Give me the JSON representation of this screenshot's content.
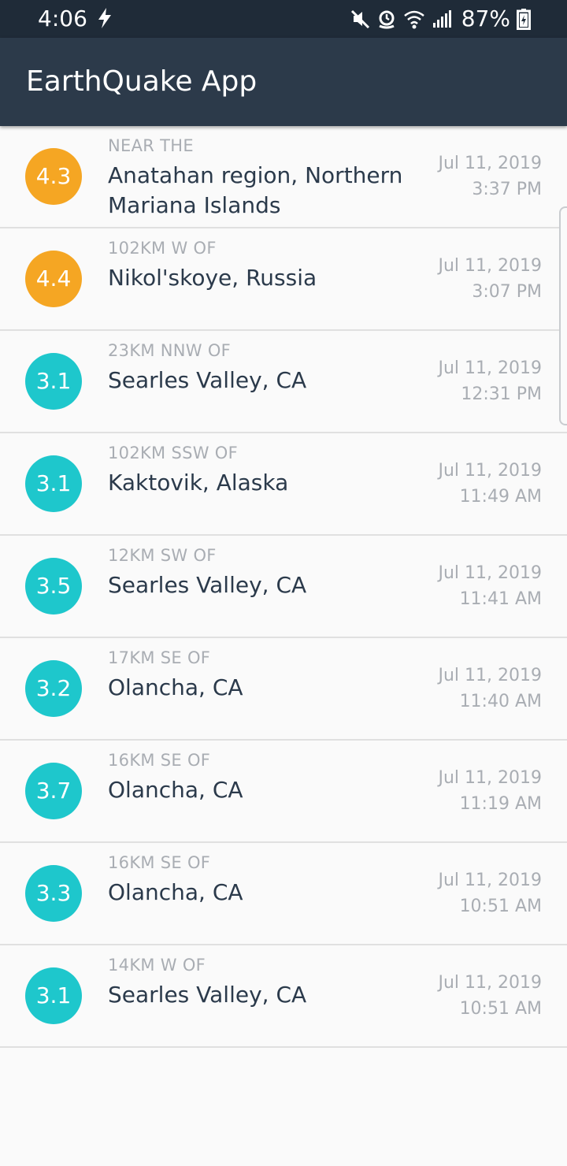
{
  "status_bar": {
    "time": "4:06",
    "battery_percent": "87%",
    "icons": [
      "flash-icon",
      "mute-icon",
      "alarm-icon",
      "wifi-icon",
      "signal-icon",
      "battery-icon"
    ]
  },
  "app_bar": {
    "title": "EarthQuake App"
  },
  "colors": {
    "status_bar": "#1f2b38",
    "app_bar": "#2c3a4a",
    "mag_orange": "#f5a623",
    "mag_teal": "#1ec7cc",
    "primary_text": "#2b3a4b",
    "secondary_text": "#a9adb3"
  },
  "earthquakes": [
    {
      "magnitude": "4.3",
      "offset": "NEAR THE",
      "location": "Anatahan region, Northern Mariana Islands",
      "date": "Jul 11, 2019",
      "time": "3:37 PM",
      "color": "#f5a623"
    },
    {
      "magnitude": "4.4",
      "offset": "102KM W OF",
      "location": "Nikol'skoye, Russia",
      "date": "Jul 11, 2019",
      "time": "3:07 PM",
      "color": "#f5a623"
    },
    {
      "magnitude": "3.1",
      "offset": "23KM NNW OF",
      "location": "Searles Valley, CA",
      "date": "Jul 11, 2019",
      "time": "12:31 PM",
      "color": "#1ec7cc"
    },
    {
      "magnitude": "3.1",
      "offset": "102KM SSW OF",
      "location": "Kaktovik, Alaska",
      "date": "Jul 11, 2019",
      "time": "11:49 AM",
      "color": "#1ec7cc"
    },
    {
      "magnitude": "3.5",
      "offset": "12KM SW OF",
      "location": "Searles Valley, CA",
      "date": "Jul 11, 2019",
      "time": "11:41 AM",
      "color": "#1ec7cc"
    },
    {
      "magnitude": "3.2",
      "offset": "17KM SE OF",
      "location": "Olancha, CA",
      "date": "Jul 11, 2019",
      "time": "11:40 AM",
      "color": "#1ec7cc"
    },
    {
      "magnitude": "3.7",
      "offset": "16KM SE OF",
      "location": "Olancha, CA",
      "date": "Jul 11, 2019",
      "time": "11:19 AM",
      "color": "#1ec7cc"
    },
    {
      "magnitude": "3.3",
      "offset": "16KM SE OF",
      "location": "Olancha, CA",
      "date": "Jul 11, 2019",
      "time": "10:51 AM",
      "color": "#1ec7cc"
    },
    {
      "magnitude": "3.1",
      "offset": "14KM W OF",
      "location": "Searles Valley, CA",
      "date": "Jul 11, 2019",
      "time": "10:51 AM",
      "color": "#1ec7cc"
    }
  ]
}
